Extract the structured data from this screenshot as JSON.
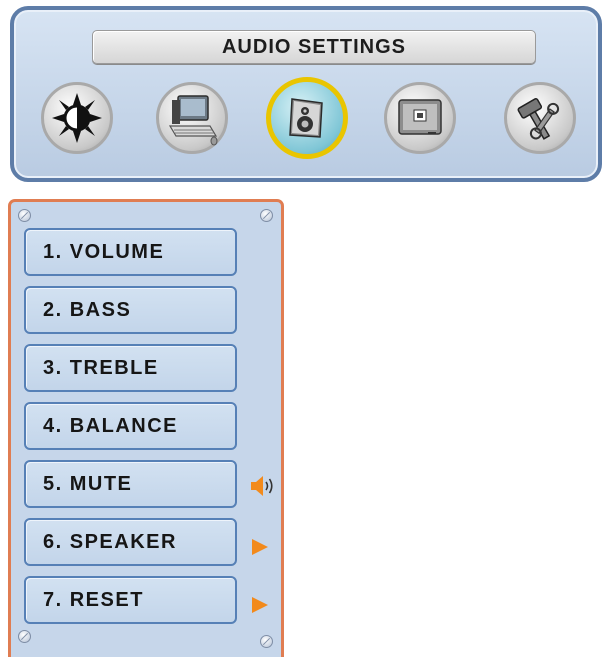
{
  "header": {
    "title": "AUDIO SETTINGS"
  },
  "tabs": [
    {
      "icon": "brightness-sun-icon",
      "active": false
    },
    {
      "icon": "computer-keyboard-icon",
      "active": false
    },
    {
      "icon": "speaker-box-icon",
      "active": true
    },
    {
      "icon": "tv-screen-icon",
      "active": false
    },
    {
      "icon": "hammer-wrench-tools-icon",
      "active": false
    }
  ],
  "menu": {
    "items": [
      {
        "label": "1. VOLUME",
        "indicator": ""
      },
      {
        "label": "2. BASS",
        "indicator": ""
      },
      {
        "label": "3. TREBLE",
        "indicator": ""
      },
      {
        "label": "4. BALANCE",
        "indicator": ""
      },
      {
        "label": "5. MUTE",
        "indicator": "speaker-sound-icon"
      },
      {
        "label": "6. SPEAKER",
        "indicator": "play-arrow-icon"
      },
      {
        "label": "7. RESET",
        "indicator": "play-arrow-icon"
      }
    ]
  },
  "colors": {
    "panel_border": "#5e7da8",
    "menu_border": "#e07d52",
    "active_ring": "#e9c500",
    "indicator_orange": "#f28a1c"
  }
}
